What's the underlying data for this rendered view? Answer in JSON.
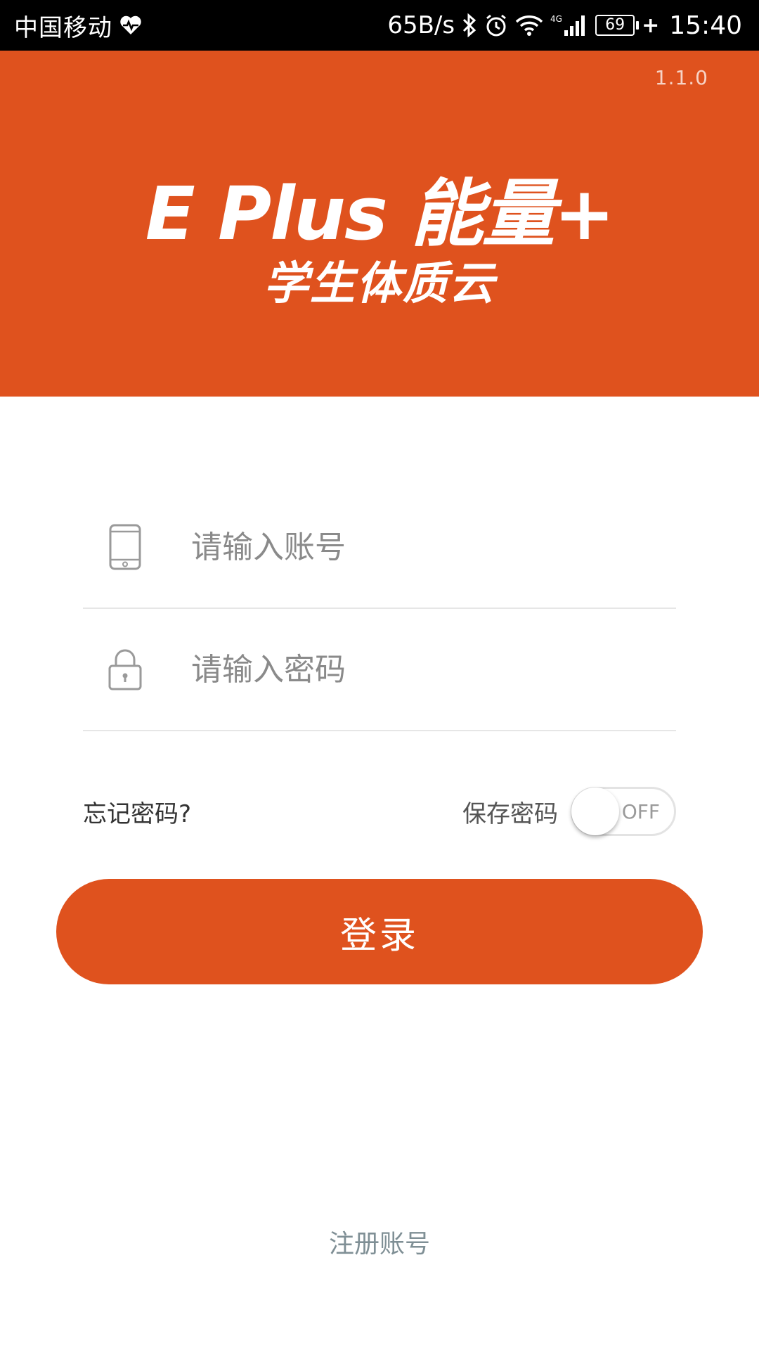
{
  "status_bar": {
    "carrier": "中国移动",
    "net_speed": "65B/s",
    "network_type": "4G",
    "battery": "69",
    "charging": "+",
    "time": "15:40",
    "icons": [
      "heart-monitor-icon",
      "bluetooth-icon",
      "alarm-icon",
      "wifi-icon",
      "signal-icon",
      "battery-icon"
    ]
  },
  "header": {
    "version": "1.1.0",
    "brand_title": "E Plus 能量+",
    "brand_subtitle": "学生体质云",
    "color": "#df521e"
  },
  "form": {
    "account": {
      "placeholder": "请输入账号",
      "value": "",
      "icon": "phone-icon"
    },
    "password": {
      "placeholder": "请输入密码",
      "value": "",
      "icon": "lock-icon"
    },
    "forgot_password": "忘记密码?",
    "save_password_label": "保存密码",
    "save_password_toggle": "OFF",
    "login_button": "登录"
  },
  "footer": {
    "register_link": "注册账号"
  }
}
